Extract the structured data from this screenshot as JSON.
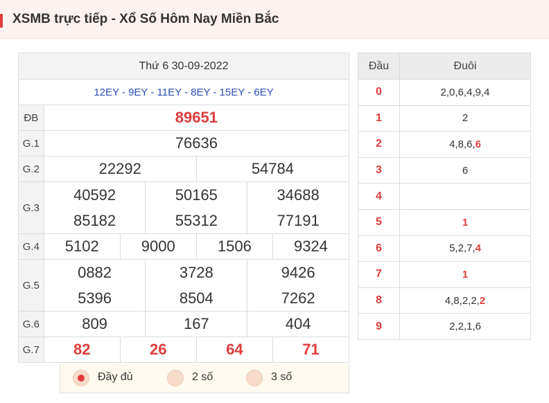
{
  "header": {
    "title": "XSMB trực tiếp - Xổ Số Hôm Nay Miền Bắc"
  },
  "results": {
    "date": "Thứ 6 30-09-2022",
    "codes": "12EY - 9EY - 11EY - 8EY - 15EY - 6EY",
    "labels": {
      "db": "ĐB",
      "g1": "G.1",
      "g2": "G.2",
      "g3": "G.3",
      "g4": "G.4",
      "g5": "G.5",
      "g6": "G.6",
      "g7": "G.7"
    },
    "db": "89651",
    "g1": "76636",
    "g2": [
      "22292",
      "54784"
    ],
    "g3": [
      "40592",
      "50165",
      "34688",
      "85182",
      "55312",
      "77191"
    ],
    "g4": [
      "5102",
      "9000",
      "1506",
      "9324"
    ],
    "g5": [
      "0882",
      "3728",
      "9426",
      "5396",
      "8504",
      "7262"
    ],
    "g6": [
      "809",
      "167",
      "404"
    ],
    "g7": [
      "82",
      "26",
      "64",
      "71"
    ]
  },
  "options": [
    {
      "label": "Đầy đủ",
      "selected": true
    },
    {
      "label": "2 số",
      "selected": false
    },
    {
      "label": "3 số",
      "selected": false
    }
  ],
  "headtail": {
    "col_head": "Đầu",
    "col_tail": "Đuôi",
    "rows": [
      {
        "head": "0",
        "tail": "2,0,6,4,9,4",
        "hl": ""
      },
      {
        "head": "1",
        "tail": "2",
        "hl": ""
      },
      {
        "head": "2",
        "tail": "4,8,6,",
        "hl": "6"
      },
      {
        "head": "3",
        "tail": "6",
        "hl": ""
      },
      {
        "head": "4",
        "tail": "",
        "hl": ""
      },
      {
        "head": "5",
        "tail": "",
        "hl": "1"
      },
      {
        "head": "6",
        "tail": "5,2,7,",
        "hl": "4"
      },
      {
        "head": "7",
        "tail": "",
        "hl": "1"
      },
      {
        "head": "8",
        "tail": "4,8,2,2,",
        "hl": "2"
      },
      {
        "head": "9",
        "tail": "2,2,1,6",
        "hl": ""
      }
    ]
  }
}
